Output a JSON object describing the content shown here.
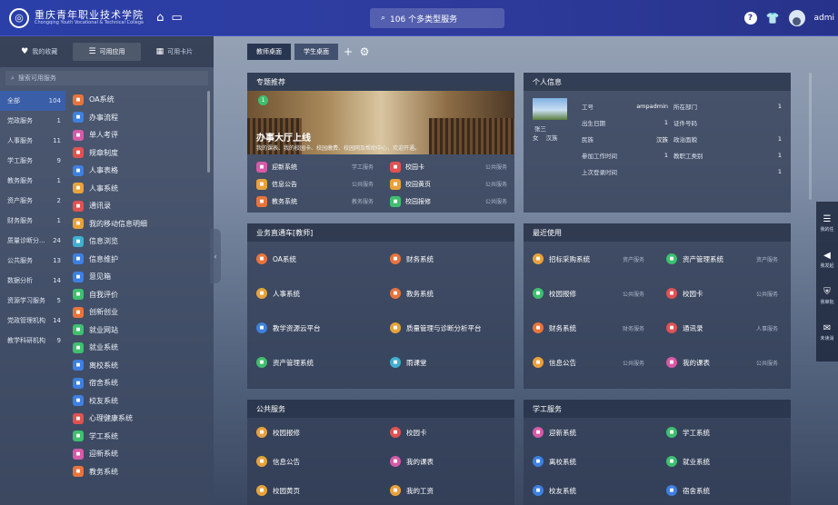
{
  "topbar": {
    "logo_cn": "重庆青年职业技术学院",
    "logo_en": "Chongqing Youth Vocational & Technical College",
    "search_text": "106 个多类型服务",
    "username": "admi"
  },
  "left": {
    "tabs": [
      {
        "glyph": "♥",
        "label": "我的收藏"
      },
      {
        "glyph": "☰",
        "label": "可用应用"
      },
      {
        "glyph": "▦",
        "label": "可用卡片"
      }
    ],
    "search_placeholder": "搜索可用服务",
    "categories": [
      {
        "name": "全部",
        "count": "104"
      },
      {
        "name": "党政服务",
        "count": "1"
      },
      {
        "name": "人事服务",
        "count": "11"
      },
      {
        "name": "学工服务",
        "count": "9"
      },
      {
        "name": "教务服务",
        "count": "1"
      },
      {
        "name": "资产服务",
        "count": "2"
      },
      {
        "name": "财务服务",
        "count": "1"
      },
      {
        "name": "质量诊断分...",
        "count": "24"
      },
      {
        "name": "公共服务",
        "count": "13"
      },
      {
        "name": "数据分析",
        "count": "14"
      },
      {
        "name": "资源学习服务",
        "count": "5"
      },
      {
        "name": "党政管理机构",
        "count": "14"
      },
      {
        "name": "教学科研机构",
        "count": "9"
      }
    ],
    "apps": [
      {
        "name": "OA系统",
        "color": "#e8743b"
      },
      {
        "name": "办事流程",
        "color": "#3f7fe0"
      },
      {
        "name": "单人考评",
        "color": "#d65aa8"
      },
      {
        "name": "规章制度",
        "color": "#e05252"
      },
      {
        "name": "人事表格",
        "color": "#3f7fe0"
      },
      {
        "name": "人事系统",
        "color": "#e8a23b"
      },
      {
        "name": "通讯录",
        "color": "#e05252"
      },
      {
        "name": "我的移动信息明细",
        "color": "#e8a23b"
      },
      {
        "name": "信息浏览",
        "color": "#3fb0d0"
      },
      {
        "name": "信息维护",
        "color": "#3f7fe0"
      },
      {
        "name": "意见箱",
        "color": "#3f7fe0"
      },
      {
        "name": "自我评价",
        "color": "#3fbf6f"
      },
      {
        "name": "创新创业",
        "color": "#e8743b"
      },
      {
        "name": "就业网站",
        "color": "#3fbf6f"
      },
      {
        "name": "就业系统",
        "color": "#3fbf6f"
      },
      {
        "name": "离校系统",
        "color": "#3f7fe0"
      },
      {
        "name": "宿舍系统",
        "color": "#3f7fe0"
      },
      {
        "name": "校友系统",
        "color": "#3f7fe0"
      },
      {
        "name": "心理健康系统",
        "color": "#e05252"
      },
      {
        "name": "学工系统",
        "color": "#3fbf6f"
      },
      {
        "name": "迎新系统",
        "color": "#d65aa8"
      },
      {
        "name": "教务系统",
        "color": "#e8743b"
      }
    ]
  },
  "desk": {
    "tabs": [
      "教师桌面",
      "学生桌面"
    ],
    "add": "+",
    "settings": "⚙"
  },
  "featured": {
    "header": "专题推荐",
    "badge": "1",
    "title": "办事大厅上线",
    "desc": "我的课表、我的校园卡、校园缴费、校园网及帮助中心，欢迎开通。",
    "items": [
      {
        "name": "迎新系统",
        "tag": "学工服务",
        "color": "#d65aa8"
      },
      {
        "name": "校园卡",
        "tag": "公共服务",
        "color": "#e05252"
      },
      {
        "name": "信息公告",
        "tag": "公共服务",
        "color": "#e8a23b"
      },
      {
        "name": "校园黄页",
        "tag": "公共服务",
        "color": "#e8a23b"
      },
      {
        "name": "教务系统",
        "tag": "教务服务",
        "color": "#e8743b"
      },
      {
        "name": "校园报修",
        "tag": "公共服务",
        "color": "#3fbf6f"
      }
    ]
  },
  "personal": {
    "header": "个人信息",
    "name": "张三",
    "gender": "女",
    "ethnicity": "汉族",
    "rows": [
      {
        "k": "工号",
        "v": "ampadmin",
        "k2": "所在部门",
        "v2": "1"
      },
      {
        "k": "出生日期",
        "v": "1",
        "k2": "证件号码",
        "v2": ""
      },
      {
        "k": "民族",
        "v": "汉族",
        "k2": "政治面貌",
        "v2": "1"
      },
      {
        "k": "参加工作时间",
        "v": "1",
        "k2": "教职工类别",
        "v2": "1"
      },
      {
        "k": "上次登录时间",
        "v": "",
        "k2": "",
        "v2": "1"
      }
    ]
  },
  "business": {
    "header": "业务直通车[教师]",
    "items": [
      {
        "name": "OA系统",
        "color": "#e8743b"
      },
      {
        "name": "财务系统",
        "color": "#e8743b"
      },
      {
        "name": "人事系统",
        "color": "#e8a23b"
      },
      {
        "name": "教务系统",
        "color": "#e8743b"
      },
      {
        "name": "教学资源云平台",
        "color": "#3f7fe0"
      },
      {
        "name": "质量管理与诊断分析平台",
        "color": "#e8a23b"
      },
      {
        "name": "资产管理系统",
        "color": "#3fbf6f"
      },
      {
        "name": "雨课堂",
        "color": "#3fb0d0"
      }
    ]
  },
  "recent": {
    "header": "最近使用",
    "items": [
      {
        "name": "招标采购系统",
        "tag": "资产服务",
        "color": "#e8a23b"
      },
      {
        "name": "资产管理系统",
        "tag": "资产服务",
        "color": "#3fbf6f"
      },
      {
        "name": "校园报修",
        "tag": "公共服务",
        "color": "#3fbf6f"
      },
      {
        "name": "校园卡",
        "tag": "公共服务",
        "color": "#e05252"
      },
      {
        "name": "财务系统",
        "tag": "财务服务",
        "color": "#e8743b"
      },
      {
        "name": "通讯录",
        "tag": "人事服务",
        "color": "#e05252"
      },
      {
        "name": "信息公告",
        "tag": "公共服务",
        "color": "#e8a23b"
      },
      {
        "name": "我的课表",
        "tag": "公共服务",
        "color": "#d65aa8"
      }
    ]
  },
  "public": {
    "header": "公共服务",
    "items": [
      {
        "name": "校园报修",
        "color": "#e8a23b"
      },
      {
        "name": "校园卡",
        "color": "#e05252"
      },
      {
        "name": "信息公告",
        "color": "#e8a23b"
      },
      {
        "name": "我的课表",
        "color": "#d65aa8"
      },
      {
        "name": "校园黄页",
        "color": "#e8a23b"
      },
      {
        "name": "我的工资",
        "color": "#e8a23b"
      }
    ]
  },
  "student": {
    "header": "学工服务",
    "items": [
      {
        "name": "迎新系统",
        "color": "#d65aa8"
      },
      {
        "name": "学工系统",
        "color": "#3fbf6f"
      },
      {
        "name": "离校系统",
        "color": "#3f7fe0"
      },
      {
        "name": "就业系统",
        "color": "#3fbf6f"
      },
      {
        "name": "校友系统",
        "color": "#3f7fe0"
      },
      {
        "name": "宿舍系统",
        "color": "#3f7fe0"
      }
    ]
  },
  "rail": [
    {
      "glyph": "☰",
      "label": "我的任"
    },
    {
      "glyph": "◀",
      "label": "我发起"
    },
    {
      "glyph": "⛨",
      "label": "我审批"
    },
    {
      "glyph": "✉",
      "label": "未读消"
    }
  ]
}
